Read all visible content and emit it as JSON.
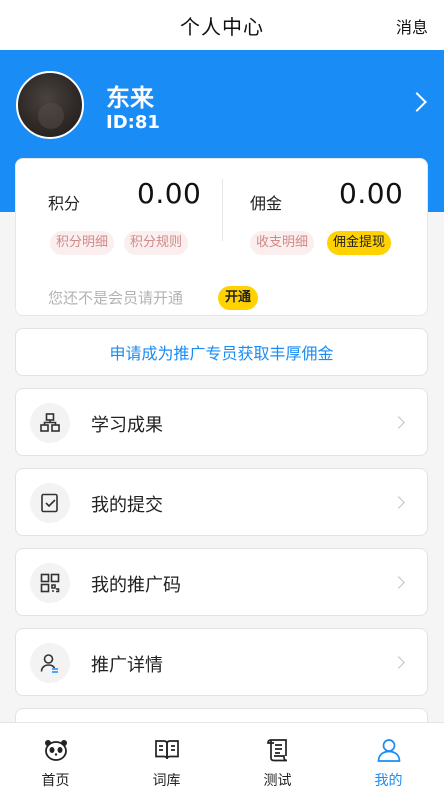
{
  "header": {
    "title": "个人中心",
    "messages_label": "消息"
  },
  "profile": {
    "name": "东来",
    "id": "ID:81"
  },
  "stats": {
    "points": {
      "label": "积分",
      "value": "0.00",
      "detail_button": "积分明细",
      "rules_button": "积分规则"
    },
    "commission": {
      "label": "佣金",
      "value": "0.00",
      "detail_button": "收支明细",
      "withdraw_button": "佣金提现"
    },
    "vip_text": "您还不是会员请开通",
    "open_button": "开通"
  },
  "promo": {
    "text": "申请成为推广专员获取丰厚佣金"
  },
  "menu": [
    {
      "label": "学习成果",
      "icon": "sitemap-icon"
    },
    {
      "label": "我的提交",
      "icon": "submit-icon"
    },
    {
      "label": "我的推广码",
      "icon": "qrcode-icon"
    },
    {
      "label": "推广详情",
      "icon": "user-detail-icon"
    }
  ],
  "tabs": [
    {
      "label": "首页",
      "icon": "panda-icon"
    },
    {
      "label": "词库",
      "icon": "book-icon"
    },
    {
      "label": "测试",
      "icon": "scroll-icon"
    },
    {
      "label": "我的",
      "icon": "user-icon"
    }
  ],
  "colors": {
    "accent": "#1a8cf5",
    "highlight": "#ffd200",
    "pill_text": "#d08a8a",
    "pill_bg": "#fbeeee"
  }
}
